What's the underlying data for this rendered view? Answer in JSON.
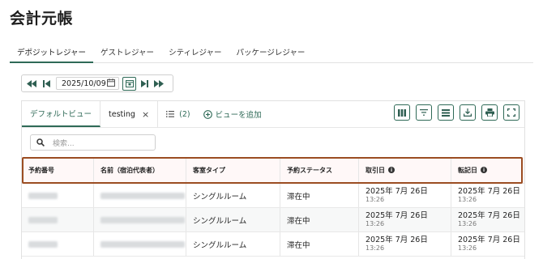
{
  "page": {
    "title": "会計元帳"
  },
  "ledger_tabs": [
    {
      "label": "デポジットレジャー",
      "active": true
    },
    {
      "label": "ゲストレジャー",
      "active": false
    },
    {
      "label": "シティレジャー",
      "active": false
    },
    {
      "label": "パッケージレジャー",
      "active": false
    }
  ],
  "date_nav": {
    "date": "2025/10/09"
  },
  "view_tabs": {
    "default_view": "デフォルトビュー",
    "named_view": "testing",
    "close_icon": "×",
    "views_count": "(2)",
    "add_view": "ビューを追加"
  },
  "toolbar": [
    {
      "icon": "columns-icon"
    },
    {
      "icon": "filter-icon"
    },
    {
      "icon": "density-icon"
    },
    {
      "icon": "download-icon"
    },
    {
      "icon": "print-icon"
    },
    {
      "icon": "fullscreen-icon"
    }
  ],
  "search": {
    "placeholder": "検索..."
  },
  "table": {
    "columns": [
      "予約番号",
      "名前（宿泊代表者）",
      "客室タイプ",
      "予約ステータス",
      "取引日",
      "転記日"
    ],
    "rows": [
      {
        "room_type": "シングルルーム",
        "status": "滞在中",
        "trans_date": "2025年 7月 26日",
        "trans_time": "13:26",
        "post_date": "2025年 7月 26日",
        "post_time": "13:26"
      },
      {
        "room_type": "シングルルーム",
        "status": "滞在中",
        "trans_date": "2025年 7月 26日",
        "trans_time": "13:26",
        "post_date": "2025年 7月 26日",
        "post_time": "13:26"
      },
      {
        "room_type": "シングルルーム",
        "status": "滞在中",
        "trans_date": "2025年 7月 26日",
        "trans_time": "13:26",
        "post_date": "2025年 7月 26日",
        "post_time": "13:26"
      }
    ]
  },
  "colors": {
    "accent": "#2f6a57",
    "highlight_border": "#9b4d22"
  }
}
